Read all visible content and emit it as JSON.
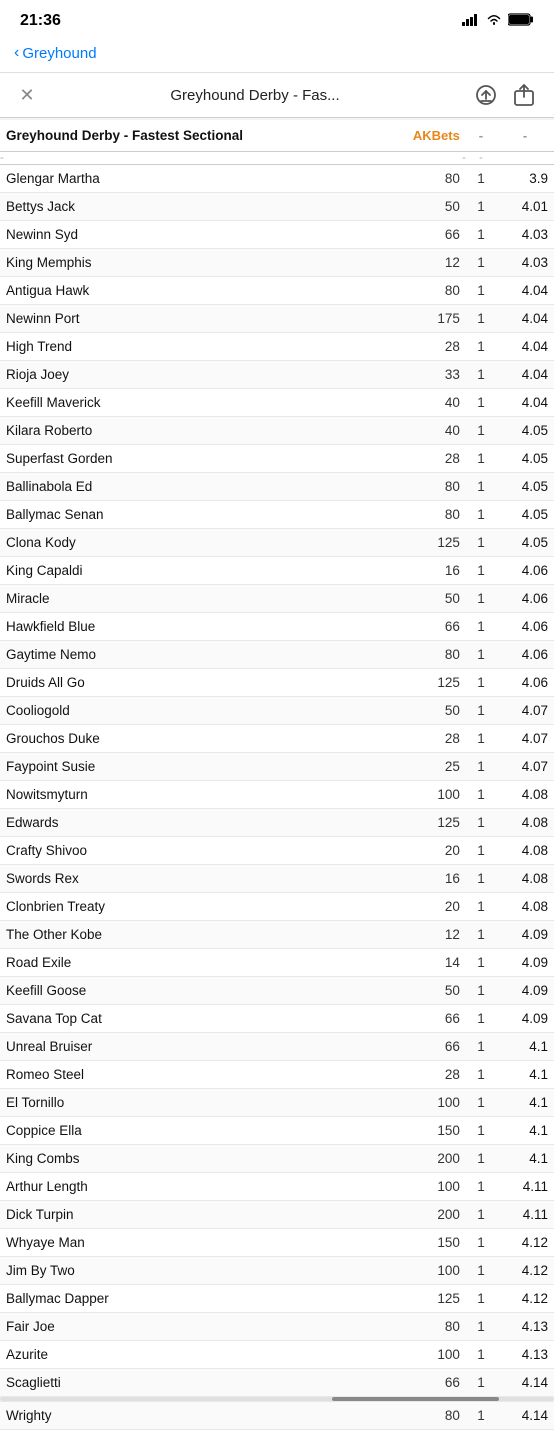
{
  "statusBar": {
    "time": "21:36",
    "signal": "●●●●",
    "wifi": "WiFi",
    "battery": "100"
  },
  "navBar": {
    "backLabel": "Greyhound"
  },
  "toolbar": {
    "closeLabel": "✕",
    "title": "Greyhound Derby - Fas...",
    "icon1": "⊕",
    "icon2": "↑"
  },
  "table": {
    "header": {
      "nameLabel": "Greyhound Derby - Fastest Sectional",
      "betsLabel": "AKBets",
      "col3": "-",
      "col4": "-"
    },
    "subheader": {
      "col2": "-",
      "col3": "-"
    },
    "rows": [
      {
        "name": "Glengar Martha",
        "num": 80,
        "one": 1,
        "dash": "",
        "dec": "3.9"
      },
      {
        "name": "Bettys Jack",
        "num": 50,
        "one": 1,
        "dash": "",
        "dec": "4.01"
      },
      {
        "name": "Newinn Syd",
        "num": 66,
        "one": 1,
        "dash": "",
        "dec": "4.03"
      },
      {
        "name": "King Memphis",
        "num": 12,
        "one": 1,
        "dash": "",
        "dec": "4.03"
      },
      {
        "name": "Antigua Hawk",
        "num": 80,
        "one": 1,
        "dash": "",
        "dec": "4.04"
      },
      {
        "name": "Newinn Port",
        "num": 175,
        "one": 1,
        "dash": "",
        "dec": "4.04"
      },
      {
        "name": "High Trend",
        "num": 28,
        "one": 1,
        "dash": "",
        "dec": "4.04"
      },
      {
        "name": "Rioja Joey",
        "num": 33,
        "one": 1,
        "dash": "",
        "dec": "4.04"
      },
      {
        "name": "Keefill Maverick",
        "num": 40,
        "one": 1,
        "dash": "",
        "dec": "4.04"
      },
      {
        "name": "Kilara Roberto",
        "num": 40,
        "one": 1,
        "dash": "",
        "dec": "4.05"
      },
      {
        "name": "Superfast Gorden",
        "num": 28,
        "one": 1,
        "dash": "",
        "dec": "4.05"
      },
      {
        "name": "Ballinabola Ed",
        "num": 80,
        "one": 1,
        "dash": "",
        "dec": "4.05"
      },
      {
        "name": "Ballymac Senan",
        "num": 80,
        "one": 1,
        "dash": "",
        "dec": "4.05"
      },
      {
        "name": "Clona Kody",
        "num": 125,
        "one": 1,
        "dash": "",
        "dec": "4.05"
      },
      {
        "name": "King Capaldi",
        "num": 16,
        "one": 1,
        "dash": "",
        "dec": "4.06"
      },
      {
        "name": "Miracle",
        "num": 50,
        "one": 1,
        "dash": "",
        "dec": "4.06"
      },
      {
        "name": "Hawkfield Blue",
        "num": 66,
        "one": 1,
        "dash": "",
        "dec": "4.06"
      },
      {
        "name": "Gaytime Nemo",
        "num": 80,
        "one": 1,
        "dash": "",
        "dec": "4.06"
      },
      {
        "name": "Druids All Go",
        "num": 125,
        "one": 1,
        "dash": "",
        "dec": "4.06"
      },
      {
        "name": "Cooliogold",
        "num": 50,
        "one": 1,
        "dash": "",
        "dec": "4.07"
      },
      {
        "name": "Grouchos Duke",
        "num": 28,
        "one": 1,
        "dash": "",
        "dec": "4.07"
      },
      {
        "name": "Faypoint Susie",
        "num": 25,
        "one": 1,
        "dash": "",
        "dec": "4.07"
      },
      {
        "name": "Nowitsmyturn",
        "num": 100,
        "one": 1,
        "dash": "",
        "dec": "4.08"
      },
      {
        "name": "Edwards",
        "num": 125,
        "one": 1,
        "dash": "",
        "dec": "4.08"
      },
      {
        "name": "Crafty Shivoo",
        "num": 20,
        "one": 1,
        "dash": "",
        "dec": "4.08"
      },
      {
        "name": "Swords Rex",
        "num": 16,
        "one": 1,
        "dash": "",
        "dec": "4.08"
      },
      {
        "name": "Clonbrien Treaty",
        "num": 20,
        "one": 1,
        "dash": "",
        "dec": "4.08"
      },
      {
        "name": "The Other Kobe",
        "num": 12,
        "one": 1,
        "dash": "-",
        "dec": "4.09"
      },
      {
        "name": "Road Exile",
        "num": 14,
        "one": 1,
        "dash": "",
        "dec": "4.09"
      },
      {
        "name": "Keefill Goose",
        "num": 50,
        "one": 1,
        "dash": "",
        "dec": "4.09"
      },
      {
        "name": "Savana Top Cat",
        "num": 66,
        "one": 1,
        "dash": "",
        "dec": "4.09"
      },
      {
        "name": "Unreal Bruiser",
        "num": 66,
        "one": 1,
        "dash": "",
        "dec": "4.1"
      },
      {
        "name": "Romeo Steel",
        "num": 28,
        "one": 1,
        "dash": "",
        "dec": "4.1"
      },
      {
        "name": "El Tornillo",
        "num": 100,
        "one": 1,
        "dash": "",
        "dec": "4.1"
      },
      {
        "name": "Coppice Ella",
        "num": 150,
        "one": 1,
        "dash": "",
        "dec": "4.1"
      },
      {
        "name": "King Combs",
        "num": 200,
        "one": 1,
        "dash": "",
        "dec": "4.1"
      },
      {
        "name": "Arthur Length",
        "num": 100,
        "one": 1,
        "dash": "",
        "dec": "4.11"
      },
      {
        "name": "Dick Turpin",
        "num": 200,
        "one": 1,
        "dash": "",
        "dec": "4.11"
      },
      {
        "name": "Whyaye Man",
        "num": 150,
        "one": 1,
        "dash": "",
        "dec": "4.12"
      },
      {
        "name": "Jim By Two",
        "num": 100,
        "one": 1,
        "dash": "",
        "dec": "4.12"
      },
      {
        "name": "Ballymac Dapper",
        "num": 125,
        "one": 1,
        "dash": "",
        "dec": "4.12"
      },
      {
        "name": "Fair Joe",
        "num": 80,
        "one": 1,
        "dash": "",
        "dec": "4.13"
      },
      {
        "name": "Azurite",
        "num": 100,
        "one": 1,
        "dash": "",
        "dec": "4.13"
      },
      {
        "name": "Scaglietti",
        "num": 66,
        "one": 1,
        "dash": "",
        "dec": "4.14"
      },
      {
        "name": "Wrighty",
        "num": 80,
        "one": 1,
        "dash": "",
        "dec": "4.14"
      }
    ]
  }
}
